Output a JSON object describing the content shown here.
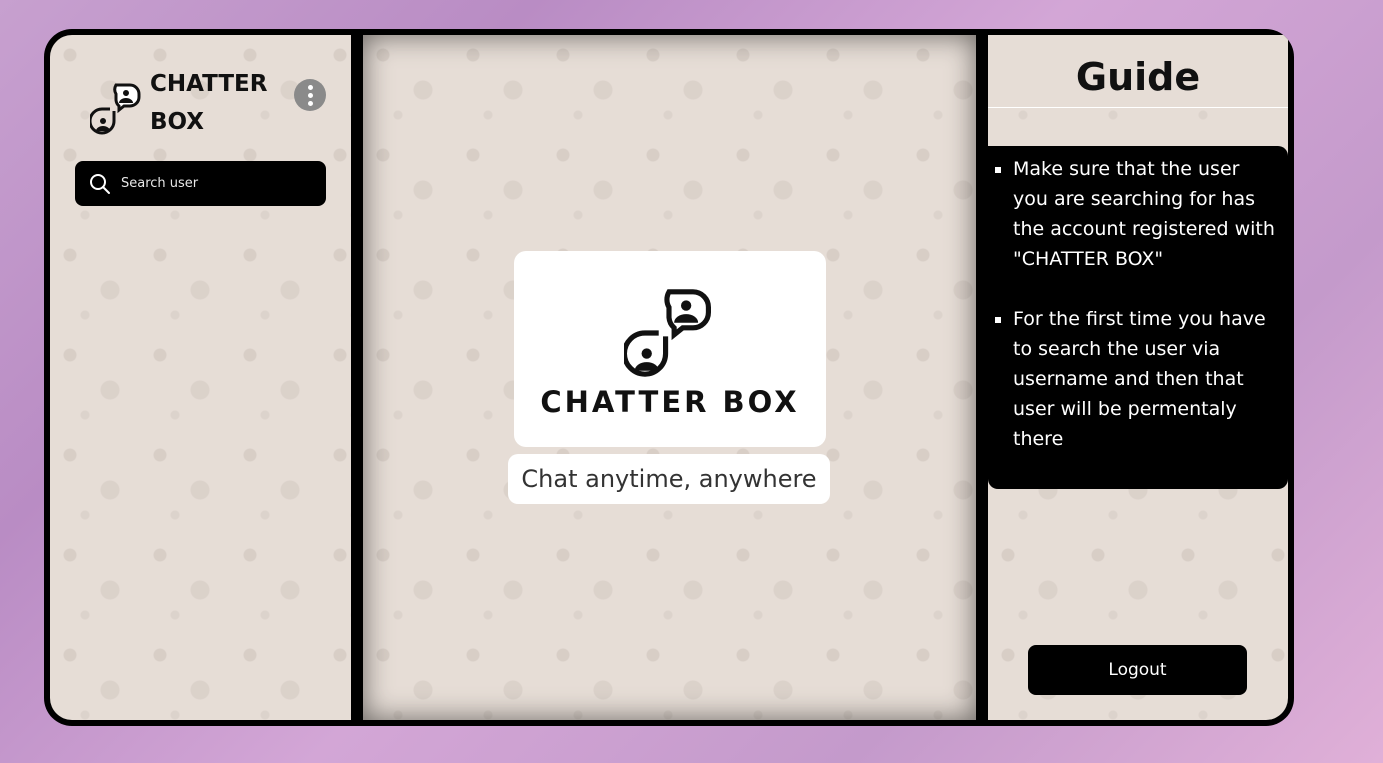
{
  "sidebar": {
    "brand_name": "CHATTER BOX",
    "menu_icon": "kebab-menu-icon",
    "search": {
      "placeholder": "Search user",
      "value": "",
      "icon": "search-icon"
    }
  },
  "main": {
    "logo_icon": "chatter-box-logo-icon",
    "logo_text": "CHATTER BOX",
    "tagline": "Chat anytime, anywhere"
  },
  "guide": {
    "title": "Guide",
    "items": [
      "Make sure that the user you are searching for has the account registered with \"CHATTER BOX\"",
      "For the first time you have to search the user via username and then that user will be permentaly there"
    ],
    "logout_label": "Logout"
  },
  "colors": {
    "panel_background": "#e6ddd6",
    "frame": "#000000",
    "accent_button": "#000000",
    "menu_button": "#8a8a8a"
  }
}
